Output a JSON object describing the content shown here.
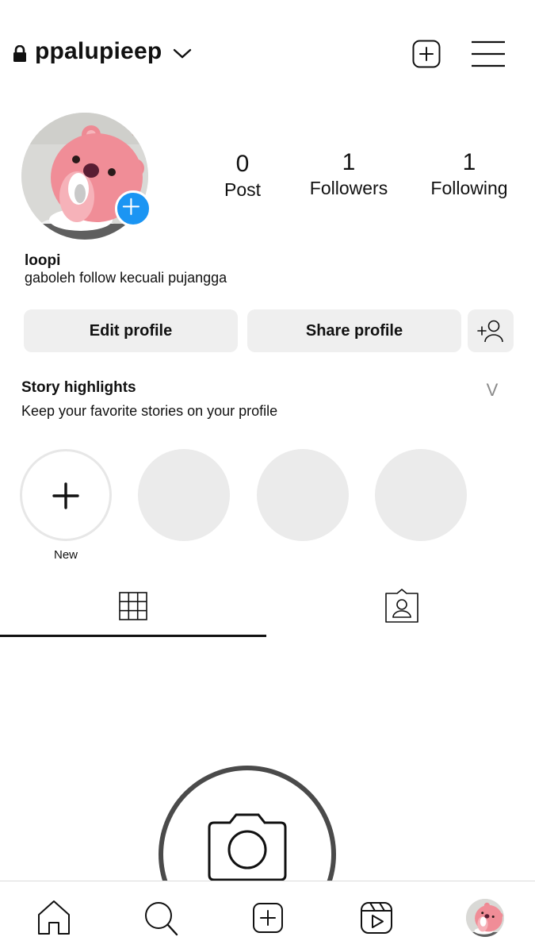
{
  "header": {
    "username": "ppalupieep"
  },
  "profile": {
    "display_name": "loopi",
    "bio": "gaboleh follow kecuali pujangga",
    "stats": [
      {
        "value": "0",
        "label": "Post"
      },
      {
        "value": "1",
        "label": "Followers"
      },
      {
        "value": "1",
        "label": "Following"
      }
    ],
    "avatar_plus_color": "#1b95f3"
  },
  "actions": {
    "edit_label": "Edit profile",
    "share_label": "Share profile"
  },
  "story_highlights": {
    "title": "Story highlights",
    "subtitle": "Keep your favorite stories on your profile",
    "toggle": "V",
    "new_label": "New"
  },
  "tabs": [
    "grid-icon",
    "tagged-icon"
  ],
  "bottom_nav": [
    "home-icon",
    "search-icon",
    "create-icon",
    "reels-icon",
    "profile-avatar"
  ]
}
